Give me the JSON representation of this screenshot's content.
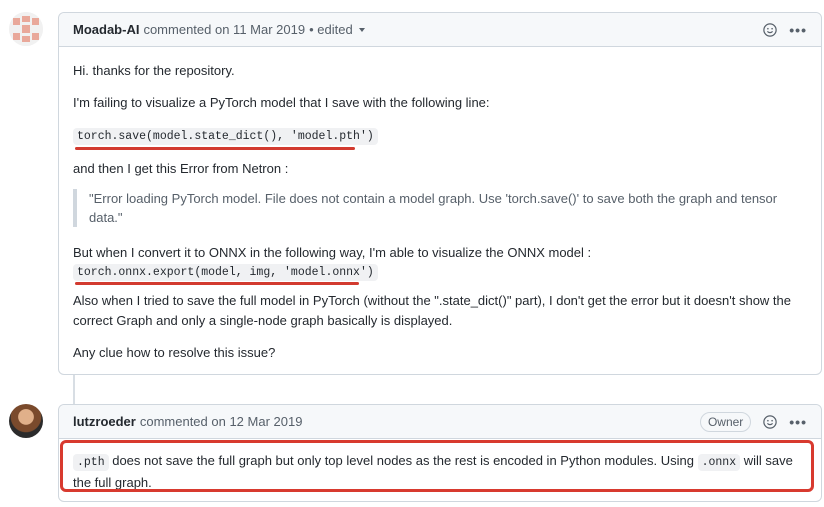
{
  "comments": [
    {
      "author": "Moadab-AI",
      "meta": "commented on 11 Mar 2019",
      "edited": "• edited",
      "body": {
        "p1": "Hi. thanks for the repository.",
        "p2": "I'm failing to visualize a PyTorch model that I save with the following line:",
        "code1": "torch.save(model.state_dict(), 'model.pth')",
        "p3": "and then I get this Error from Netron :",
        "quote": "\"Error loading PyTorch model. File does not contain a model graph. Use 'torch.save()' to save both the graph and tensor data.\"",
        "p4": "But when I convert it to ONNX in the following way, I'm able to visualize the ONNX model :",
        "code2": "torch.onnx.export(model, img, 'model.onnx')",
        "p5": "Also when I tried to save the full model in PyTorch (without the \".state_dict()\" part), I don't get the error but it doesn't show the correct Graph and only a single-node graph basically is displayed.",
        "p6": "Any clue how to resolve this issue?"
      }
    },
    {
      "author": "lutzroeder",
      "meta": "commented on 12 Mar 2019",
      "badge": "Owner",
      "body": {
        "code_pth": ".pth",
        "text_a": " does not save the full graph but only top level nodes as the rest is encoded in Python modules. Using ",
        "code_onnx": ".onnx",
        "text_b": " will save the full graph."
      }
    }
  ],
  "colors": {
    "annotation_red": "#d83a2f",
    "border": "#d0d7de",
    "header_bg": "#f6f8fa"
  }
}
